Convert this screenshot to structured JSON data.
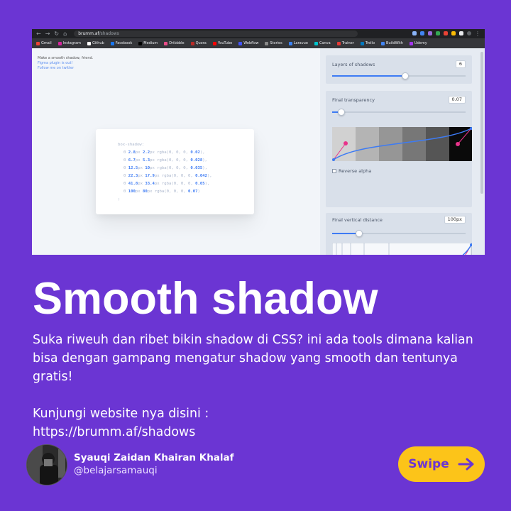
{
  "browser": {
    "url_host": "brumm.af",
    "url_path": "/shadows",
    "bookmarks": [
      {
        "label": "Gmail",
        "color": "#ea4335"
      },
      {
        "label": "Instagram",
        "color": "#d6249f"
      },
      {
        "label": "Github",
        "color": "#ffffff"
      },
      {
        "label": "Facebook",
        "color": "#1877f2"
      },
      {
        "label": "Medium",
        "color": "#000000"
      },
      {
        "label": "Dribbble",
        "color": "#ea4c89"
      },
      {
        "label": "Quora",
        "color": "#b92b27"
      },
      {
        "label": "YouTube",
        "color": "#ff0000"
      },
      {
        "label": "Webflow",
        "color": "#4353ff"
      },
      {
        "label": "Stories",
        "color": "#888888"
      },
      {
        "label": "Laravue",
        "color": "#3b82f6"
      },
      {
        "label": "Canva",
        "color": "#00c4cc"
      },
      {
        "label": "Trainer",
        "color": "#e53935"
      },
      {
        "label": "Trello",
        "color": "#0079bf"
      },
      {
        "label": "BuildWith",
        "color": "#4285f4"
      },
      {
        "label": "Udemy",
        "color": "#a435f0"
      }
    ]
  },
  "page": {
    "intro": "Make a smooth shadow, friend.",
    "figma_link": "Figma plugin is out!",
    "twitter_link": "Follow me on twitter",
    "code": {
      "header": "box-shadow:",
      "lines": [
        {
          "a": "2.8",
          "b": "2.2",
          "alpha": "0.02"
        },
        {
          "a": "6.7",
          "b": "5.3",
          "alpha": "0.028"
        },
        {
          "a": "12.5",
          "b": "10",
          "alpha": "0.035"
        },
        {
          "a": "22.3",
          "b": "17.9",
          "alpha": "0.042"
        },
        {
          "a": "41.8",
          "b": "33.4",
          "alpha": "0.05"
        },
        {
          "a": "100",
          "b": "80",
          "alpha": "0.07"
        }
      ],
      "close": ";"
    }
  },
  "panel": {
    "layers": {
      "label": "Layers of shadows",
      "value": "6",
      "fraction": 0.55
    },
    "transparency": {
      "label": "Final transparency",
      "value": "0.07",
      "fraction": 0.07,
      "reverse_label": "Reverse alpha"
    },
    "distance": {
      "label": "Final vertical distance",
      "value": "100px",
      "fraction": 0.2
    }
  },
  "headline": "Smooth shadow",
  "description": "Suka riweuh dan ribet bikin shadow di CSS? ini ada tools dimana kalian bisa dengan gampang mengatur shadow yang smooth dan tentunya gratis!",
  "visit_line1": "Kunjungi website nya disini :",
  "visit_line2": "https://brumm.af/shadows",
  "author": {
    "name": "Syauqi Zaidan Khairan Khalaf",
    "handle": "@belajarsamauqi"
  },
  "swipe_label": "Swipe",
  "colors": {
    "background": "#6b35d3",
    "swipe_button": "#fcc419",
    "accent_blue": "#3d7bf4",
    "accent_pink": "#e8338a"
  }
}
